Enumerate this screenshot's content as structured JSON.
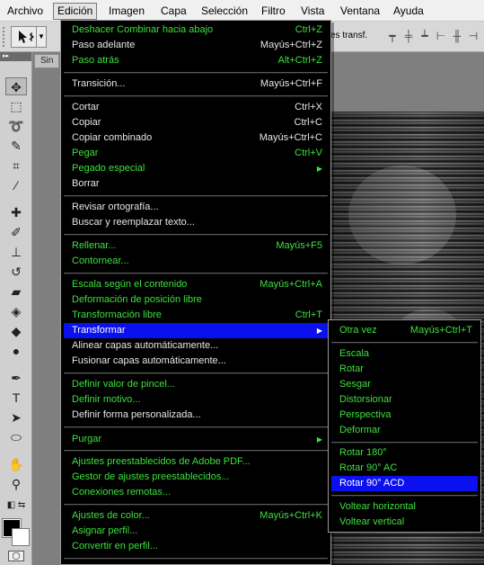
{
  "menubar": {
    "items": [
      "Archivo",
      "Edición",
      "Imagen",
      "Capa",
      "Selección",
      "Filtro",
      "Vista",
      "Ventana",
      "Ayuda"
    ],
    "active": "Edición"
  },
  "optbar": {
    "transform_label": "es transf."
  },
  "doc": {
    "tab_label": "Sin"
  },
  "edit_menu": {
    "items": [
      {
        "label": "Deshacer Combinar hacia abajo",
        "shortcut": "Ctrl+Z",
        "style": "green"
      },
      {
        "label": "Paso adelante",
        "shortcut": "Mayús+Ctrl+Z",
        "style": "normal"
      },
      {
        "label": "Paso atrás",
        "shortcut": "Alt+Ctrl+Z",
        "style": "green"
      },
      {
        "label": "Transición...",
        "shortcut": "Mayús+Ctrl+F",
        "style": "normal"
      },
      {
        "label": "Cortar",
        "shortcut": "Ctrl+X",
        "style": "normal"
      },
      {
        "label": "Copiar",
        "shortcut": "Ctrl+C",
        "style": "normal"
      },
      {
        "label": "Copiar combinado",
        "shortcut": "Mayús+Ctrl+C",
        "style": "normal"
      },
      {
        "label": "Pegar",
        "shortcut": "Ctrl+V",
        "style": "green"
      },
      {
        "label": "Pegado especial",
        "shortcut": "",
        "style": "green",
        "submenu": true
      },
      {
        "label": "Borrar",
        "shortcut": "",
        "style": "normal"
      },
      {
        "label": "Revisar ortografía...",
        "shortcut": "",
        "style": "normal"
      },
      {
        "label": "Buscar y reemplazar texto...",
        "shortcut": "",
        "style": "normal"
      },
      {
        "label": "Rellenar...",
        "shortcut": "Mayús+F5",
        "style": "green"
      },
      {
        "label": "Contornear...",
        "shortcut": "",
        "style": "green"
      },
      {
        "label": "Escala según el contenido",
        "shortcut": "Mayús+Ctrl+A",
        "style": "green"
      },
      {
        "label": "Deformación de posición libre",
        "shortcut": "",
        "style": "green"
      },
      {
        "label": "Transformación libre",
        "shortcut": "Ctrl+T",
        "style": "green"
      },
      {
        "label": "Transformar",
        "shortcut": "",
        "style": "highlight",
        "submenu": true
      },
      {
        "label": "Alinear capas automáticamente...",
        "shortcut": "",
        "style": "normal"
      },
      {
        "label": "Fusionar capas automáticamente...",
        "shortcut": "",
        "style": "normal"
      },
      {
        "label": "Definir valor de pincel...",
        "shortcut": "",
        "style": "green"
      },
      {
        "label": "Definir motivo...",
        "shortcut": "",
        "style": "green"
      },
      {
        "label": "Definir forma personalizada...",
        "shortcut": "",
        "style": "normal"
      },
      {
        "label": "Purgar",
        "shortcut": "",
        "style": "green",
        "submenu": true
      },
      {
        "label": "Ajustes preestablecidos de Adobe PDF...",
        "shortcut": "",
        "style": "green"
      },
      {
        "label": "Gestor de ajustes preestablecidos...",
        "shortcut": "",
        "style": "green"
      },
      {
        "label": "Conexiones remotas...",
        "shortcut": "",
        "style": "green"
      },
      {
        "label": "Ajustes de color...",
        "shortcut": "Mayús+Ctrl+K",
        "style": "green"
      },
      {
        "label": "Asignar perfil...",
        "shortcut": "",
        "style": "green"
      },
      {
        "label": "Convertir en perfil...",
        "shortcut": "",
        "style": "green"
      }
    ]
  },
  "transform_menu": {
    "items": [
      {
        "label": "Otra vez",
        "shortcut": "Mayús+Ctrl+T",
        "style": "green"
      },
      {
        "label": "Escala",
        "shortcut": "",
        "style": "green"
      },
      {
        "label": "Rotar",
        "shortcut": "",
        "style": "green"
      },
      {
        "label": "Sesgar",
        "shortcut": "",
        "style": "green"
      },
      {
        "label": "Distorsionar",
        "shortcut": "",
        "style": "green"
      },
      {
        "label": "Perspectiva",
        "shortcut": "",
        "style": "green"
      },
      {
        "label": "Deformar",
        "shortcut": "",
        "style": "green"
      },
      {
        "label": "Rotar 180°",
        "shortcut": "",
        "style": "green"
      },
      {
        "label": "Rotar 90° AC",
        "shortcut": "",
        "style": "green"
      },
      {
        "label": "Rotar 90° ACD",
        "shortcut": "",
        "style": "highlight"
      },
      {
        "label": "Voltear horizontal",
        "shortcut": "",
        "style": "green"
      },
      {
        "label": "Voltear vertical",
        "shortcut": "",
        "style": "green"
      }
    ]
  },
  "colors": {
    "menu_bg": "#000000",
    "menu_text_green": "#3ee03e",
    "menu_text_normal": "#e6e6e6",
    "highlight": "#0a10ee"
  },
  "tools": [
    "move-tool-icon",
    "marquee-tool-icon",
    "lasso-tool-icon",
    "quick-selection-tool-icon",
    "crop-tool-icon",
    "eyedropper-tool-icon",
    "healing-brush-tool-icon",
    "brush-tool-icon",
    "clone-stamp-tool-icon",
    "history-brush-tool-icon",
    "eraser-tool-icon",
    "paint-bucket-tool-icon",
    "blur-tool-icon",
    "dodge-tool-icon",
    "pen-tool-icon",
    "type-tool-icon",
    "path-selection-tool-icon",
    "ellipse-tool-icon",
    "hand-tool-icon",
    "zoom-tool-icon"
  ]
}
